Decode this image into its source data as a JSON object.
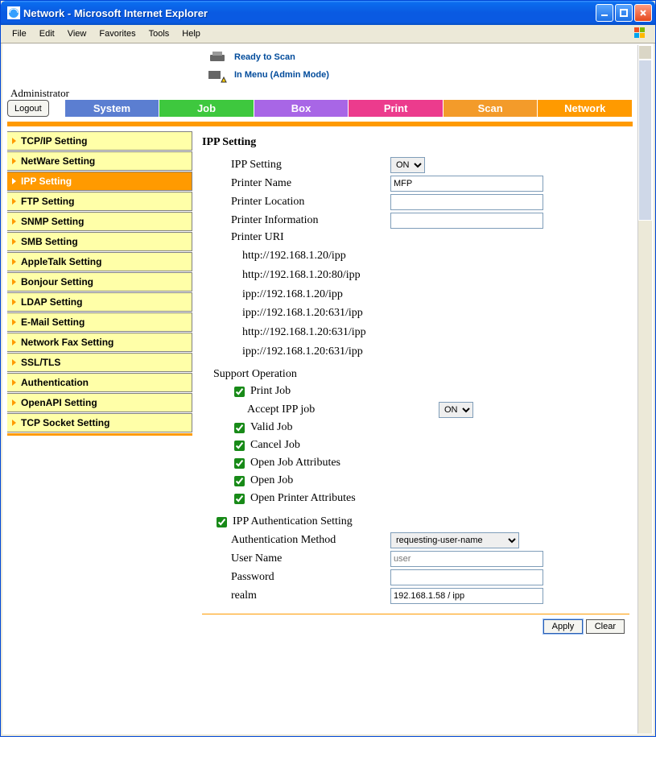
{
  "window": {
    "title": "Network - Microsoft Internet Explorer"
  },
  "menubar": {
    "items": [
      "File",
      "Edit",
      "View",
      "Favorites",
      "Tools",
      "Help"
    ]
  },
  "status": {
    "line1": "Ready to Scan",
    "line2": "In Menu (Admin Mode)"
  },
  "admin_label": "Administrator",
  "logout_label": "Logout",
  "tabs": [
    "System",
    "Job",
    "Box",
    "Print",
    "Scan",
    "Network"
  ],
  "sidebar": {
    "items": [
      {
        "label": "TCP/IP Setting"
      },
      {
        "label": "NetWare Setting"
      },
      {
        "label": "IPP Setting",
        "active": true
      },
      {
        "label": "FTP Setting"
      },
      {
        "label": "SNMP Setting"
      },
      {
        "label": "SMB Setting"
      },
      {
        "label": "AppleTalk Setting"
      },
      {
        "label": "Bonjour Setting"
      },
      {
        "label": "LDAP Setting"
      },
      {
        "label": "E-Mail Setting"
      },
      {
        "label": "Network Fax Setting"
      },
      {
        "label": "SSL/TLS"
      },
      {
        "label": "Authentication"
      },
      {
        "label": "OpenAPI Setting"
      },
      {
        "label": "TCP Socket Setting"
      }
    ]
  },
  "main": {
    "heading": "IPP Setting",
    "ipp_setting": {
      "label": "IPP Setting",
      "value": "ON"
    },
    "printer_name": {
      "label": "Printer Name",
      "value": "MFP"
    },
    "printer_location": {
      "label": "Printer Location",
      "value": ""
    },
    "printer_info": {
      "label": "Printer Information",
      "value": ""
    },
    "printer_uri_label": "Printer URI",
    "printer_uris": [
      "http://192.168.1.20/ipp",
      "http://192.168.1.20:80/ipp",
      "ipp://192.168.1.20/ipp",
      "ipp://192.168.1.20:631/ipp",
      "http://192.168.1.20:631/ipp",
      "ipp://192.168.1.20:631/ipp"
    ],
    "support_op_label": "Support Operation",
    "ops": {
      "print_job": {
        "label": "Print Job",
        "checked": true
      },
      "accept_ipp": {
        "label": "Accept IPP job",
        "value": "ON"
      },
      "valid_job": {
        "label": "Valid Job",
        "checked": true
      },
      "cancel_job": {
        "label": "Cancel Job",
        "checked": true
      },
      "open_job_attr": {
        "label": "Open Job Attributes",
        "checked": true
      },
      "open_job": {
        "label": "Open Job",
        "checked": true
      },
      "open_printer_attr": {
        "label": "Open Printer Attributes",
        "checked": true
      }
    },
    "ipp_auth": {
      "label": "IPP Authentication Setting",
      "checked": true
    },
    "auth_method": {
      "label": "Authentication Method",
      "value": "requesting-user-name"
    },
    "user_name": {
      "label": "User Name",
      "placeholder": "user",
      "value": ""
    },
    "password": {
      "label": "Password",
      "value": ""
    },
    "realm": {
      "label": "realm",
      "value": "192.168.1.58 / ipp"
    },
    "buttons": {
      "apply": "Apply",
      "clear": "Clear"
    }
  }
}
